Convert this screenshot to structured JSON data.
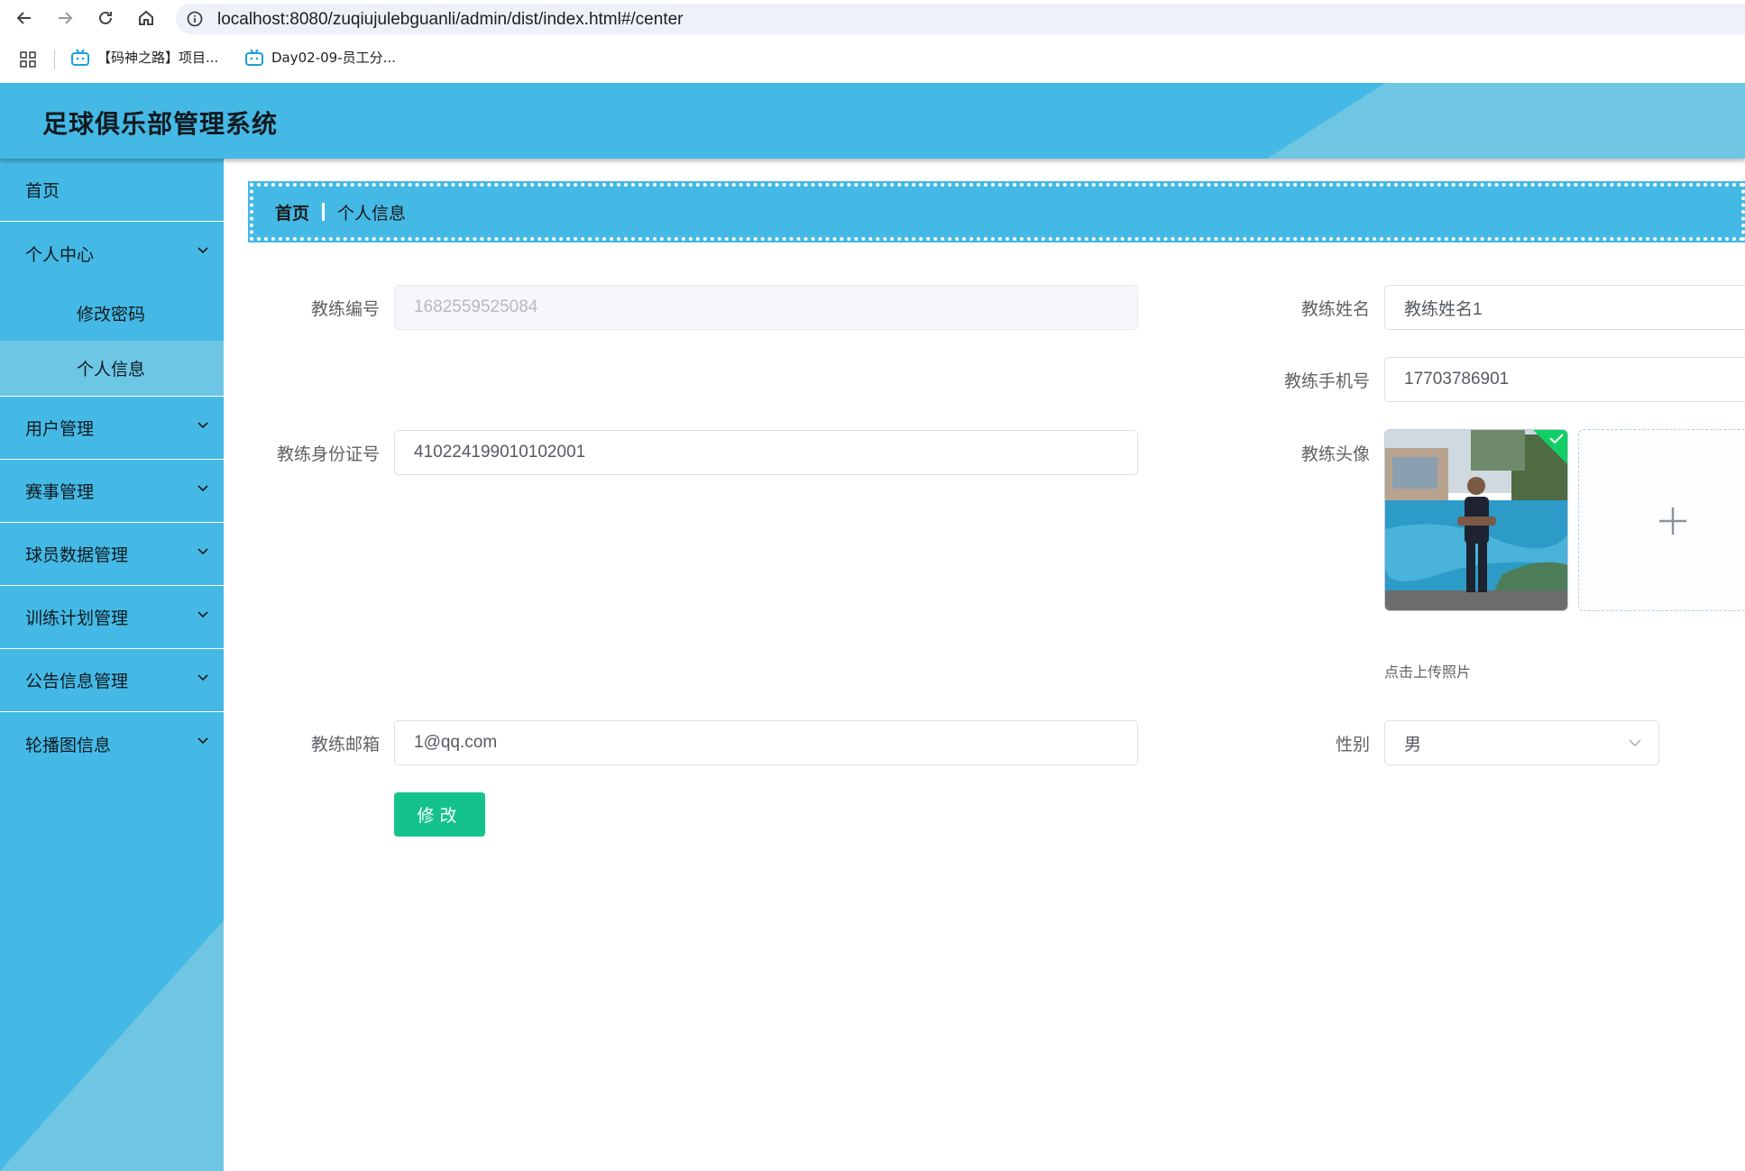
{
  "browser": {
    "url": "localhost:8080/zuqiujulebguanli/admin/dist/index.html#/center",
    "bookmarks": [
      {
        "label": "【码神之路】项目..."
      },
      {
        "label": "Day02-09-员工分..."
      }
    ]
  },
  "header": {
    "title": "足球俱乐部管理系统"
  },
  "sidebar": {
    "home": "首页",
    "personal_center": "个人中心",
    "change_password": "修改密码",
    "personal_info": "个人信息",
    "user_mgmt": "用户管理",
    "match_mgmt": "赛事管理",
    "player_data_mgmt": "球员数据管理",
    "training_plan_mgmt": "训练计划管理",
    "notice_mgmt": "公告信息管理",
    "carousel_info": "轮播图信息"
  },
  "breadcrumb": {
    "home": "首页",
    "current": "个人信息"
  },
  "form": {
    "coach_no_label": "教练编号",
    "coach_no_value": "1682559525084",
    "coach_name_label": "教练姓名",
    "coach_name_value": "教练姓名1",
    "coach_phone_label": "教练手机号",
    "coach_phone_value": "17703786901",
    "coach_id_label": "教练身份证号",
    "coach_id_value": "410224199010102001",
    "coach_avatar_label": "教练头像",
    "upload_tip": "点击上传照片",
    "coach_email_label": "教练邮箱",
    "coach_email_value": "1@qq.com",
    "gender_label": "性别",
    "gender_value": "男",
    "submit_label": "修改"
  }
}
